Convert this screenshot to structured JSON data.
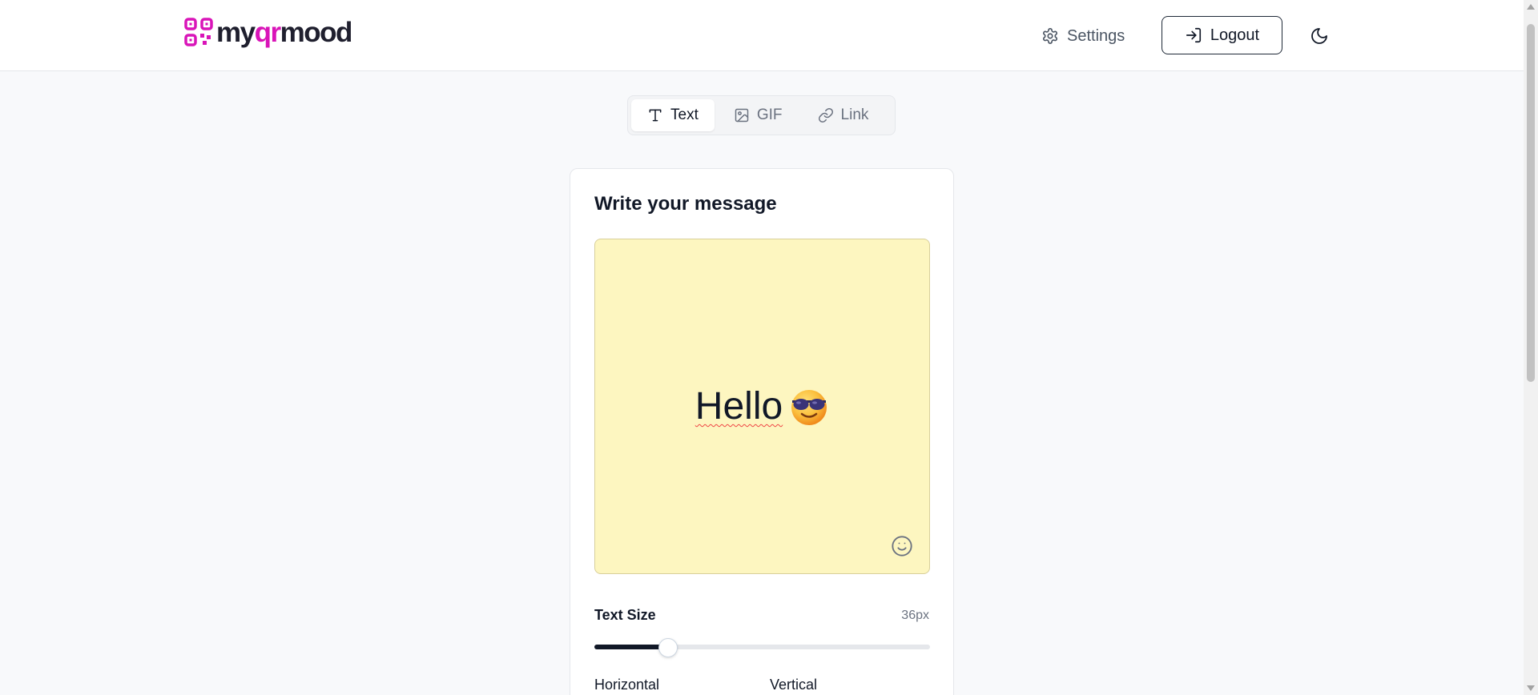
{
  "header": {
    "logo": {
      "prefix": "my",
      "highlight": "qr",
      "suffix": "mood",
      "brand_color": "#d914b8"
    },
    "settings_label": "Settings",
    "settings_icon": "gear-icon",
    "logout_label": "Logout",
    "logout_icon": "logout-icon",
    "theme_icon": "moon-icon"
  },
  "tabs": [
    {
      "label": "Text",
      "icon": "text-icon",
      "active": true
    },
    {
      "label": "GIF",
      "icon": "image-icon",
      "active": false
    },
    {
      "label": "Link",
      "icon": "link-icon",
      "active": false
    }
  ],
  "card": {
    "title": "Write your message",
    "editor": {
      "text": "Hello",
      "emoji": "smiling-face-with-sunglasses",
      "background_color": "#fdf6c0"
    },
    "text_size": {
      "label": "Text Size",
      "value": "36px",
      "fraction": 0.22
    },
    "alignment": {
      "horizontal_label": "Horizontal",
      "vertical_label": "Vertical"
    }
  }
}
